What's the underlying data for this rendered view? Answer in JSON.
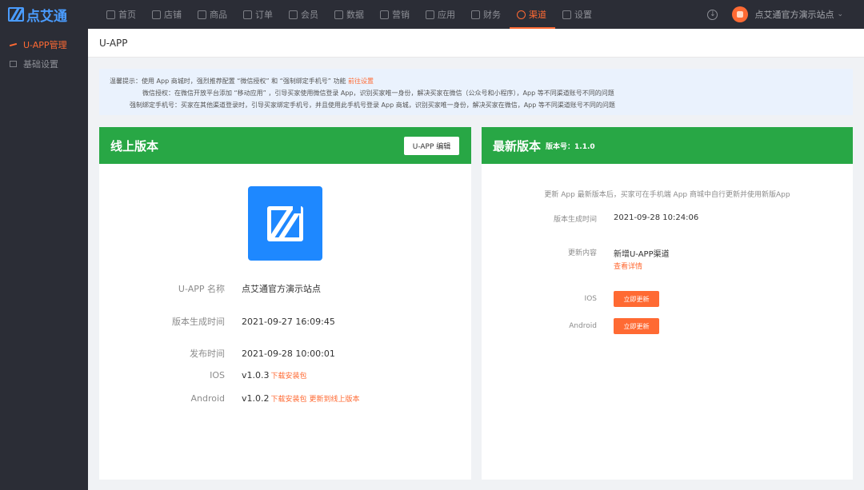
{
  "brand": {
    "name": "点艾通"
  },
  "nav": [
    {
      "label": "首页",
      "icon": "home-icon"
    },
    {
      "label": "店铺",
      "icon": "store-icon"
    },
    {
      "label": "商品",
      "icon": "goods-icon"
    },
    {
      "label": "订单",
      "icon": "order-icon"
    },
    {
      "label": "会员",
      "icon": "member-icon"
    },
    {
      "label": "数据",
      "icon": "data-icon"
    },
    {
      "label": "营销",
      "icon": "marketing-icon"
    },
    {
      "label": "应用",
      "icon": "apps-icon"
    },
    {
      "label": "财务",
      "icon": "finance-icon"
    },
    {
      "label": "渠道",
      "icon": "channel-icon",
      "active": true
    },
    {
      "label": "设置",
      "icon": "settings-icon"
    }
  ],
  "top_right": {
    "site_name": "点艾通官方演示站点",
    "caret": "⌄",
    "download_icon": "↓"
  },
  "sidebar": [
    {
      "label": "U-APP管理",
      "active": true
    },
    {
      "label": "基础设置"
    }
  ],
  "breadcrumb": "U-APP",
  "notice": {
    "line1": "温馨提示：使用 App 商城时，强烈推荐配置 “微信授权” 和 “强制绑定手机号” 功能",
    "line1_link": "前往设置",
    "line2": "微信授权：在微信开放平台添加 “移动应用” ，引导买家使用微信登录 App，识别买家唯一身份，解决买家在微信（公众号和小程序），App 等不同渠道账号不同的问题",
    "line3": "强制绑定手机号：买家在其他渠道登录时，引导买家绑定手机号，并且使用此手机号登录 App 商城，识别买家唯一身份，解决买家在微信，App 等不同渠道账号不同的问题"
  },
  "online": {
    "title": "线上版本",
    "edit_button": "U-APP 编辑",
    "app_name_label": "U-APP 名称",
    "app_name": "点艾通官方演示站点",
    "build_time_label": "版本生成时间",
    "build_time": "2021-09-27 16:09:45",
    "publish_time_label": "发布时间",
    "publish_time": "2021-09-28 10:00:01",
    "ios_label": "IOS",
    "ios_version": "v1.0.3",
    "ios_download": "下载安装包",
    "android_label": "Android",
    "android_version": "v1.0.2",
    "android_download": "下载安装包",
    "android_update": "更新到线上版本"
  },
  "latest": {
    "title": "最新版本",
    "version_label": "版本号：1.1.0",
    "note": "更新 App 最新版本后，买家可在手机端 App 商城中自行更新并使用新版App",
    "build_time_label": "版本生成时间",
    "build_time": "2021-09-28 10:24:06",
    "content_label": "更新内容",
    "content": "新增U-APP渠道",
    "content_more": "查看详情",
    "ios_label": "IOS",
    "ios_button": "立即更新",
    "android_label": "Android",
    "android_button": "立即更新"
  },
  "colors": {
    "accent": "#ff6a33",
    "header_green": "#28a745",
    "nav_bg": "#2b2d36",
    "app_blue": "#1e88ff"
  }
}
